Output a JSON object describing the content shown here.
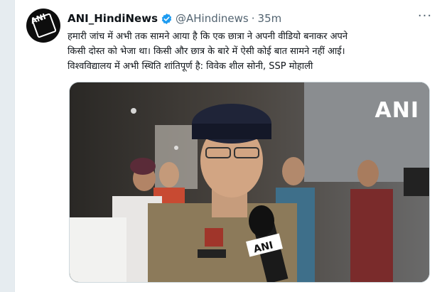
{
  "tweet": {
    "display_name": "ANI_HindiNews",
    "handle": "@AHindinews",
    "separator": "·",
    "time": "35m",
    "more_label": "···",
    "text_lines": [
      "हमारी जांच में अभी तक सामने आया है कि एक छात्रा ने अपनी वीडियो बनाकर अपने",
      "किसी दोस्त को भेजा था। किसी और छात्र के बारे में ऐसी कोई बात सामने नहीं आई।",
      "विश्वविद्यालय में अभी स्थिति शांतिपूर्ण है: विवेक शील सोनी, SSP मोहाली"
    ],
    "verified_color": "#1d9bf0"
  },
  "avatar": {
    "logo_text": "ANI",
    "background": "#0d0d0d"
  },
  "media": {
    "watermark": "ANI",
    "mic_label": "ANI",
    "description_icons": [
      "microphone-icon",
      "police-cap"
    ]
  }
}
